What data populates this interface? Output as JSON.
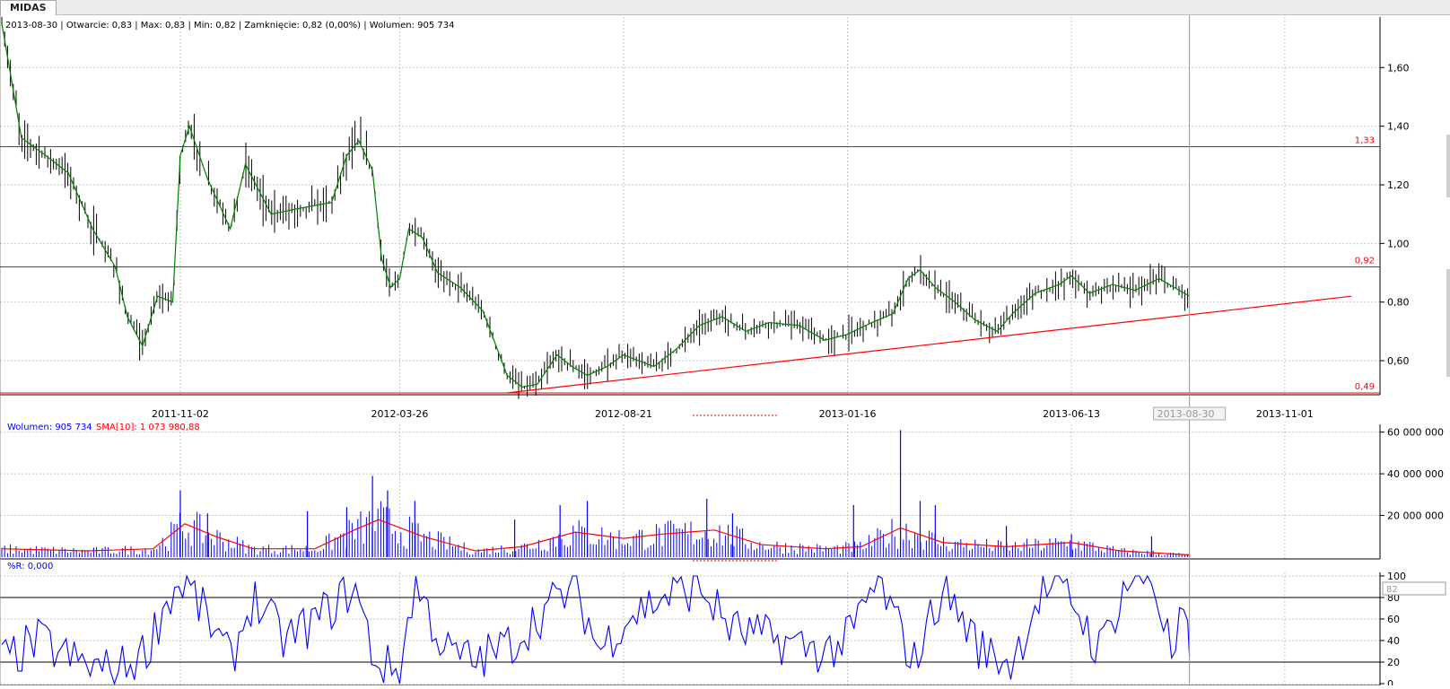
{
  "tab": {
    "label": "MIDAS"
  },
  "price_info": "2013-08-30 | Otwarcie: 0,83 | Max: 0,83 | Min: 0,82 | Zamknięcie: 0,82 (0,00%) | Wolumen: 905 734",
  "volume_info": {
    "volume": "Wolumen: 905 734",
    "sma": "SMA[10]: 1 073 980,88"
  },
  "wr_info": "%R: 0,000",
  "wr_level_box": "82",
  "cursor_date": "2013-08-30",
  "colors": {
    "price": "#000000",
    "ma": "#008000",
    "levels": "#ff0000",
    "volume": "#0000ff",
    "volume_sma": "#ff0000",
    "wr": "#0000ff",
    "grid": "#c8c8c8"
  },
  "chart_data": [
    {
      "type": "ohlc",
      "name": "price",
      "x_ticks": [
        "2011-11-02",
        "2012-03-26",
        "2012-08-21",
        "2013-01-16",
        "2013-06-13",
        "2013-08-30",
        "2013-11-01"
      ],
      "y_ticks": [
        "0,60",
        "0,80",
        "1,00",
        "1,20",
        "1,40",
        "1,60"
      ],
      "ylim": [
        0.49,
        1.76
      ],
      "x_range": [
        "2011-07-07",
        "2013-12-31"
      ],
      "levels": [
        {
          "value": 1.33,
          "label": "1,33"
        },
        {
          "value": 0.92,
          "label": "0,92"
        },
        {
          "value": 0.49,
          "label": "0,49"
        }
      ],
      "trendline": [
        {
          "x": "2012-06-05",
          "y": 0.49
        },
        {
          "x": "2013-12-15",
          "y": 0.82
        }
      ],
      "cursor": "2013-08-30",
      "close": [
        {
          "x": "2011-07-07",
          "y": 1.75
        },
        {
          "x": "2011-07-20",
          "y": 1.36
        },
        {
          "x": "2011-08-05",
          "y": 1.3
        },
        {
          "x": "2011-08-20",
          "y": 1.24
        },
        {
          "x": "2011-09-05",
          "y": 1.05
        },
        {
          "x": "2011-09-20",
          "y": 0.92
        },
        {
          "x": "2011-09-28",
          "y": 0.75
        },
        {
          "x": "2011-10-08",
          "y": 0.65
        },
        {
          "x": "2011-10-18",
          "y": 0.82
        },
        {
          "x": "2011-10-28",
          "y": 0.8
        },
        {
          "x": "2011-11-02",
          "y": 1.3
        },
        {
          "x": "2011-11-08",
          "y": 1.4
        },
        {
          "x": "2011-11-20",
          "y": 1.22
        },
        {
          "x": "2011-12-05",
          "y": 1.05
        },
        {
          "x": "2011-12-15",
          "y": 1.27
        },
        {
          "x": "2012-01-01",
          "y": 1.1
        },
        {
          "x": "2012-01-20",
          "y": 1.12
        },
        {
          "x": "2012-02-10",
          "y": 1.14
        },
        {
          "x": "2012-02-20",
          "y": 1.3
        },
        {
          "x": "2012-02-28",
          "y": 1.35
        },
        {
          "x": "2012-03-08",
          "y": 1.25
        },
        {
          "x": "2012-03-14",
          "y": 0.95
        },
        {
          "x": "2012-03-20",
          "y": 0.85
        },
        {
          "x": "2012-03-26",
          "y": 0.88
        },
        {
          "x": "2012-04-01",
          "y": 1.05
        },
        {
          "x": "2012-04-10",
          "y": 1.02
        },
        {
          "x": "2012-04-20",
          "y": 0.9
        },
        {
          "x": "2012-05-05",
          "y": 0.85
        },
        {
          "x": "2012-05-20",
          "y": 0.77
        },
        {
          "x": "2012-06-05",
          "y": 0.55
        },
        {
          "x": "2012-06-15",
          "y": 0.51
        },
        {
          "x": "2012-06-25",
          "y": 0.52
        },
        {
          "x": "2012-07-08",
          "y": 0.62
        },
        {
          "x": "2012-07-18",
          "y": 0.58
        },
        {
          "x": "2012-07-28",
          "y": 0.55
        },
        {
          "x": "2012-08-10",
          "y": 0.58
        },
        {
          "x": "2012-08-21",
          "y": 0.62
        },
        {
          "x": "2012-09-10",
          "y": 0.58
        },
        {
          "x": "2012-09-25",
          "y": 0.64
        },
        {
          "x": "2012-10-10",
          "y": 0.72
        },
        {
          "x": "2012-10-25",
          "y": 0.75
        },
        {
          "x": "2012-11-10",
          "y": 0.7
        },
        {
          "x": "2012-11-25",
          "y": 0.73
        },
        {
          "x": "2012-12-15",
          "y": 0.72
        },
        {
          "x": "2013-01-01",
          "y": 0.67
        },
        {
          "x": "2013-01-16",
          "y": 0.69
        },
        {
          "x": "2013-02-01",
          "y": 0.73
        },
        {
          "x": "2013-02-15",
          "y": 0.76
        },
        {
          "x": "2013-02-25",
          "y": 0.88
        },
        {
          "x": "2013-03-05",
          "y": 0.91
        },
        {
          "x": "2013-03-15",
          "y": 0.85
        },
        {
          "x": "2013-03-28",
          "y": 0.8
        },
        {
          "x": "2013-04-10",
          "y": 0.74
        },
        {
          "x": "2013-04-25",
          "y": 0.7
        },
        {
          "x": "2013-05-05",
          "y": 0.76
        },
        {
          "x": "2013-05-20",
          "y": 0.83
        },
        {
          "x": "2013-06-05",
          "y": 0.86
        },
        {
          "x": "2013-06-13",
          "y": 0.89
        },
        {
          "x": "2013-06-25",
          "y": 0.83
        },
        {
          "x": "2013-07-10",
          "y": 0.86
        },
        {
          "x": "2013-07-25",
          "y": 0.84
        },
        {
          "x": "2013-08-10",
          "y": 0.88
        },
        {
          "x": "2013-08-20",
          "y": 0.85
        },
        {
          "x": "2013-08-30",
          "y": 0.82
        }
      ]
    },
    {
      "type": "bar",
      "name": "volume",
      "y_ticks": [
        "20 000 000",
        "40 000 000",
        "60 000 000"
      ],
      "ylim": [
        0,
        62000000
      ],
      "spikes": [
        {
          "x": "2011-11-02",
          "y": 32000000
        },
        {
          "x": "2011-11-20",
          "y": 21000000
        },
        {
          "x": "2012-01-25",
          "y": 22000000
        },
        {
          "x": "2012-02-20",
          "y": 24000000
        },
        {
          "x": "2012-03-08",
          "y": 39000000
        },
        {
          "x": "2012-03-18",
          "y": 32000000
        },
        {
          "x": "2012-04-05",
          "y": 27000000
        },
        {
          "x": "2012-06-10",
          "y": 18000000
        },
        {
          "x": "2012-07-10",
          "y": 25000000
        },
        {
          "x": "2012-07-28",
          "y": 27000000
        },
        {
          "x": "2012-10-15",
          "y": 28000000
        },
        {
          "x": "2012-11-01",
          "y": 21000000
        },
        {
          "x": "2013-01-20",
          "y": 25000000
        },
        {
          "x": "2013-02-20",
          "y": 61000000
        },
        {
          "x": "2013-03-05",
          "y": 27000000
        },
        {
          "x": "2013-03-15",
          "y": 25000000
        },
        {
          "x": "2013-05-01",
          "y": 15000000
        },
        {
          "x": "2013-06-13",
          "y": 11000000
        },
        {
          "x": "2013-08-05",
          "y": 10000000
        },
        {
          "x": "2013-08-30",
          "y": 905734
        }
      ],
      "sma": [
        {
          "x": "2011-07-07",
          "y": 4000000
        },
        {
          "x": "2011-09-01",
          "y": 3000000
        },
        {
          "x": "2011-10-15",
          "y": 4000000
        },
        {
          "x": "2011-11-05",
          "y": 16000000
        },
        {
          "x": "2011-11-25",
          "y": 10000000
        },
        {
          "x": "2011-12-20",
          "y": 4000000
        },
        {
          "x": "2012-01-30",
          "y": 4000000
        },
        {
          "x": "2012-02-25",
          "y": 13000000
        },
        {
          "x": "2012-03-12",
          "y": 18000000
        },
        {
          "x": "2012-04-10",
          "y": 10000000
        },
        {
          "x": "2012-05-15",
          "y": 3000000
        },
        {
          "x": "2012-06-15",
          "y": 5000000
        },
        {
          "x": "2012-07-20",
          "y": 12000000
        },
        {
          "x": "2012-08-21",
          "y": 9000000
        },
        {
          "x": "2012-09-15",
          "y": 11000000
        },
        {
          "x": "2012-10-20",
          "y": 13000000
        },
        {
          "x": "2012-11-20",
          "y": 6000000
        },
        {
          "x": "2013-01-01",
          "y": 4000000
        },
        {
          "x": "2013-01-25",
          "y": 5000000
        },
        {
          "x": "2013-02-20",
          "y": 14000000
        },
        {
          "x": "2013-03-20",
          "y": 7000000
        },
        {
          "x": "2013-05-01",
          "y": 5000000
        },
        {
          "x": "2013-06-13",
          "y": 7000000
        },
        {
          "x": "2013-07-15",
          "y": 3000000
        },
        {
          "x": "2013-08-30",
          "y": 1073981
        }
      ]
    },
    {
      "type": "line",
      "name": "%R",
      "y_ticks": [
        "0",
        "20",
        "40",
        "60",
        "80",
        "100"
      ],
      "ylim": [
        0,
        100
      ],
      "levels": [
        20,
        80
      ],
      "values": [
        {
          "x": "2011-07-07",
          "y": 20
        },
        {
          "x": "2011-08-01",
          "y": 40
        },
        {
          "x": "2011-08-25",
          "y": 20
        },
        {
          "x": "2011-09-20",
          "y": 10
        },
        {
          "x": "2011-10-10",
          "y": 30
        },
        {
          "x": "2011-10-25",
          "y": 80
        },
        {
          "x": "2011-11-05",
          "y": 95
        },
        {
          "x": "2011-11-20",
          "y": 60
        },
        {
          "x": "2011-12-05",
          "y": 20
        },
        {
          "x": "2011-12-20",
          "y": 80
        },
        {
          "x": "2012-01-10",
          "y": 40
        },
        {
          "x": "2012-02-01",
          "y": 60
        },
        {
          "x": "2012-02-25",
          "y": 90
        },
        {
          "x": "2012-03-10",
          "y": 20
        },
        {
          "x": "2012-03-26",
          "y": 10
        },
        {
          "x": "2012-04-05",
          "y": 95
        },
        {
          "x": "2012-04-25",
          "y": 30
        },
        {
          "x": "2012-05-15",
          "y": 20
        },
        {
          "x": "2012-06-10",
          "y": 40
        },
        {
          "x": "2012-07-01",
          "y": 70
        },
        {
          "x": "2012-07-20",
          "y": 90
        },
        {
          "x": "2012-08-05",
          "y": 30
        },
        {
          "x": "2012-08-21",
          "y": 60
        },
        {
          "x": "2012-09-15",
          "y": 80
        },
        {
          "x": "2012-10-10",
          "y": 90
        },
        {
          "x": "2012-11-01",
          "y": 50
        },
        {
          "x": "2012-12-01",
          "y": 40
        },
        {
          "x": "2013-01-01",
          "y": 30
        },
        {
          "x": "2013-01-16",
          "y": 40
        },
        {
          "x": "2013-02-05",
          "y": 95
        },
        {
          "x": "2013-03-01",
          "y": 20
        },
        {
          "x": "2013-03-20",
          "y": 90
        },
        {
          "x": "2013-04-15",
          "y": 30
        },
        {
          "x": "2013-05-05",
          "y": 20
        },
        {
          "x": "2013-05-25",
          "y": 90
        },
        {
          "x": "2013-06-13",
          "y": 80
        },
        {
          "x": "2013-07-01",
          "y": 30
        },
        {
          "x": "2013-07-20",
          "y": 95
        },
        {
          "x": "2013-08-05",
          "y": 100
        },
        {
          "x": "2013-08-20",
          "y": 20
        },
        {
          "x": "2013-08-26",
          "y": 70
        },
        {
          "x": "2013-08-30",
          "y": 25
        }
      ]
    }
  ]
}
